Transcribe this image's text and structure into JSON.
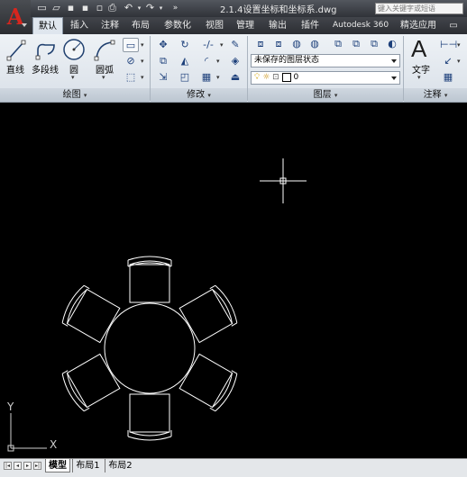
{
  "window": {
    "title": "2.1.4设置坐标和坐标系.dwg",
    "search_placeholder": "键入关键字或短语",
    "app_menu_letter": "A"
  },
  "tabs": [
    {
      "label": "默认",
      "active": true
    },
    {
      "label": "插入",
      "active": false
    },
    {
      "label": "注释",
      "active": false
    },
    {
      "label": "布局",
      "active": false
    },
    {
      "label": "参数化",
      "active": false
    },
    {
      "label": "视图",
      "active": false
    },
    {
      "label": "管理",
      "active": false
    },
    {
      "label": "输出",
      "active": false
    },
    {
      "label": "插件",
      "active": false
    },
    {
      "label": "Autodesk 360",
      "active": false
    },
    {
      "label": "精选应用",
      "active": false
    }
  ],
  "draw_panel": {
    "title": "绘图",
    "line": "直线",
    "polyline": "多段线",
    "circle": "圆",
    "arc": "圆弧"
  },
  "modify_panel": {
    "title": "修改"
  },
  "layer_panel": {
    "title": "图层",
    "state_combo": "未保存的图层状态",
    "current_layer": "0"
  },
  "annotation_panel": {
    "title": "注释",
    "text": "文字"
  },
  "ucs": {
    "x_label": "X",
    "y_label": "Y"
  },
  "layout_tabs": [
    {
      "label": "模型",
      "active": true
    },
    {
      "label": "布局1",
      "active": false
    },
    {
      "label": "布局2",
      "active": false
    }
  ],
  "colors": {
    "canvas": "#000000",
    "drawing": "#ffffff",
    "app_red": "#d7261e"
  }
}
